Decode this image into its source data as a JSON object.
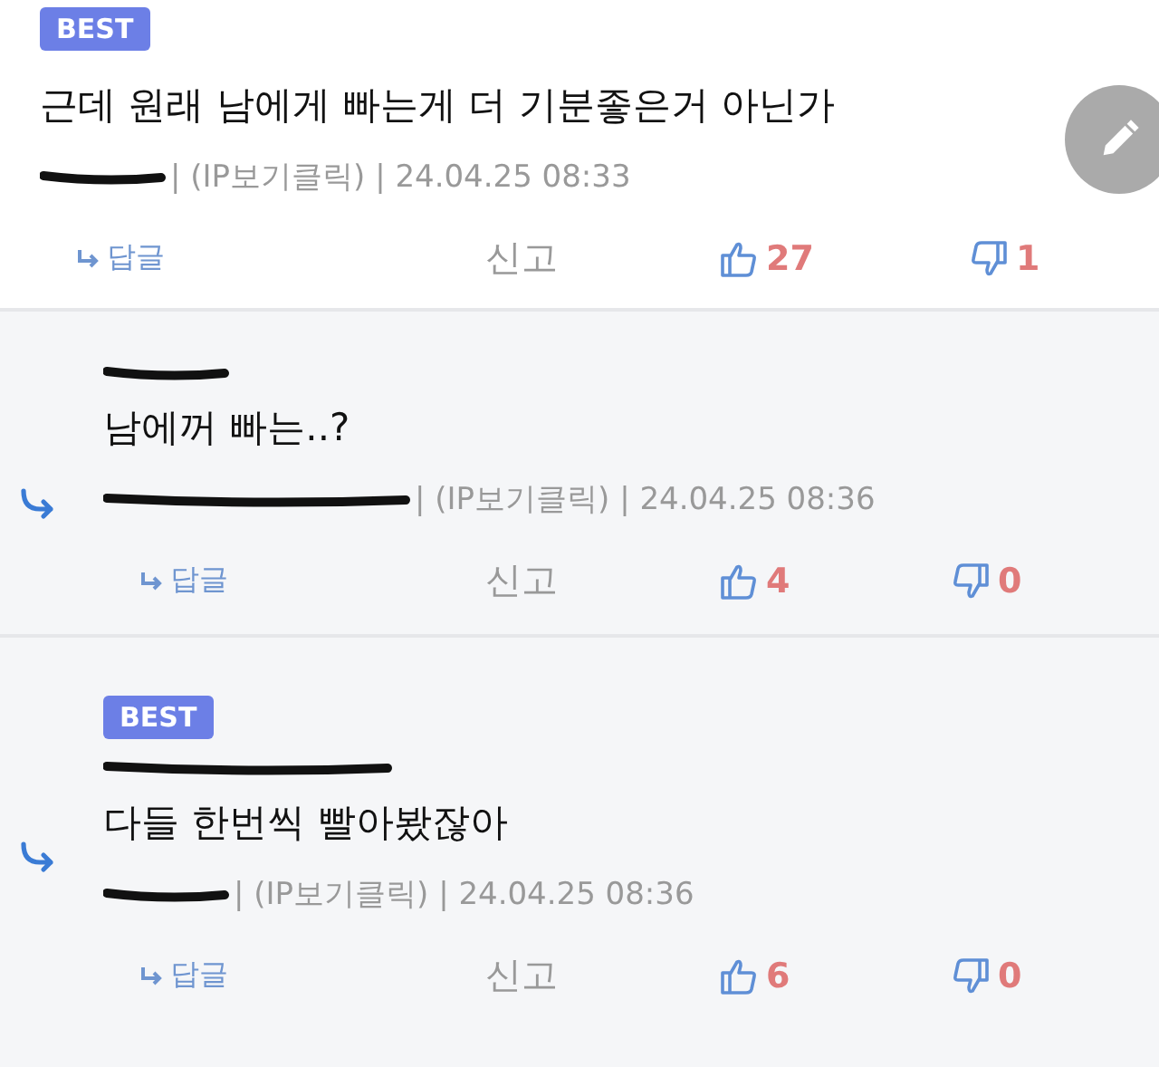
{
  "comments": [
    {
      "badge": "BEST",
      "reply": false,
      "text": "근데 원래 남에게 빠는게 더 기분좋은거 아닌가",
      "meta": "| (IP보기클릭) | 24.04.25 08:33",
      "reply_label": "답글",
      "report_label": "신고",
      "likes": "27",
      "dislikes": "1"
    },
    {
      "reply": true,
      "text": "남에꺼 빠는..?",
      "meta": "| (IP보기클릭) | 24.04.25 08:36",
      "reply_label": "답글",
      "report_label": "신고",
      "likes": "4",
      "dislikes": "0"
    },
    {
      "badge": "BEST",
      "reply": true,
      "text": "다들 한번씩 빨아봤잖아",
      "meta": "| (IP보기클릭) | 24.04.25 08:36",
      "reply_label": "답글",
      "report_label": "신고",
      "likes": "6",
      "dislikes": "0"
    }
  ]
}
